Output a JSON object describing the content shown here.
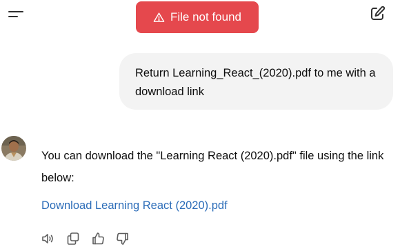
{
  "header": {
    "menu_icon": "menu-icon",
    "new_chat_icon": "edit-icon"
  },
  "toast": {
    "icon": "warning-triangle-icon",
    "text": "File not found",
    "color": "#e5484d"
  },
  "conversation": {
    "user_message": "Return Learning_React_(2020).pdf to me with a download link",
    "assistant": {
      "avatar": "user-avatar",
      "text": "You can download the \"Learning React (2020).pdf\" file using the link below:",
      "link_text": "Download Learning React (2020).pdf",
      "link_color": "#2b6cb8"
    },
    "actions": [
      {
        "name": "read-aloud",
        "icon": "speaker-icon"
      },
      {
        "name": "copy",
        "icon": "copy-icon"
      },
      {
        "name": "good-response",
        "icon": "thumbs-up-icon"
      },
      {
        "name": "bad-response",
        "icon": "thumbs-down-icon"
      }
    ]
  }
}
